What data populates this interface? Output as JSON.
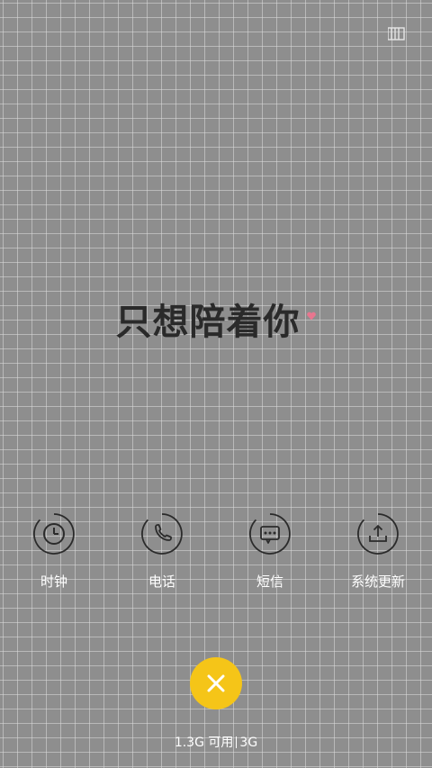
{
  "wallpaper": {
    "text": "只想陪着你"
  },
  "shortcuts": [
    {
      "label": "时钟",
      "icon": "clock-icon"
    },
    {
      "label": "电话",
      "icon": "phone-icon"
    },
    {
      "label": "短信",
      "icon": "message-icon"
    },
    {
      "label": "系统更新",
      "icon": "upload-icon"
    }
  ],
  "memory": {
    "available": "1.3G 可用",
    "total": "3G"
  },
  "colors": {
    "accent": "#f5c518",
    "background": "#8e8e8e",
    "heart": "#e8768f"
  }
}
